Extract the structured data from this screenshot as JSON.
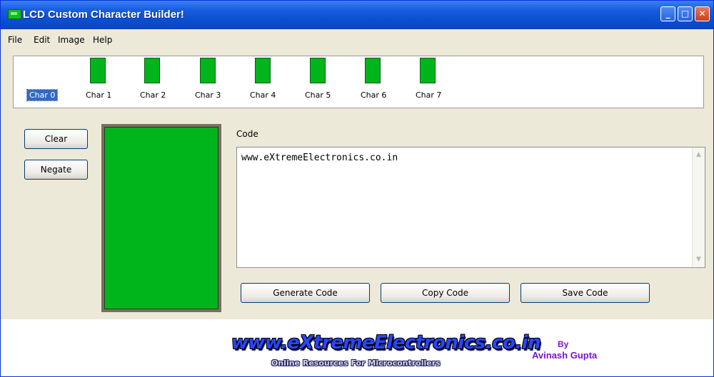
{
  "window": {
    "title": "LCD Custom Character Builder!",
    "controls": {
      "minimize": "_",
      "maximize": "□",
      "close": "✕"
    }
  },
  "menu": [
    "File",
    "Edit",
    "Image",
    "Help"
  ],
  "characters": {
    "selected_index": 0,
    "items": [
      {
        "label": "Char 0",
        "has_preview": false
      },
      {
        "label": "Char 1",
        "has_preview": true
      },
      {
        "label": "Char 2",
        "has_preview": true
      },
      {
        "label": "Char 3",
        "has_preview": true
      },
      {
        "label": "Char 4",
        "has_preview": true
      },
      {
        "label": "Char 5",
        "has_preview": true
      },
      {
        "label": "Char 6",
        "has_preview": true
      },
      {
        "label": "Char 7",
        "has_preview": true
      }
    ]
  },
  "buttons": {
    "clear": "Clear",
    "negate": "Negate",
    "generate": "Generate Code",
    "copy": "Copy Code",
    "save": "Save Code"
  },
  "code": {
    "label": "Code",
    "value": "www.eXtremeElectronics.co.in"
  },
  "footer": {
    "logo": "www.eXtremeElectronics.co.in",
    "tagline": "Online Resources For Microcontrollers",
    "by": "By",
    "author": "Avinash Gupta"
  },
  "colors": {
    "pixel_on": "#00b51c",
    "title_bar": "#0a4ed0",
    "selection": "#316ac5",
    "author_text": "#7b14d6"
  },
  "icons": {
    "app": "lcd-app-icon",
    "scroll_up": "scroll-up-arrow-icon",
    "scroll_down": "scroll-down-arrow-icon"
  }
}
